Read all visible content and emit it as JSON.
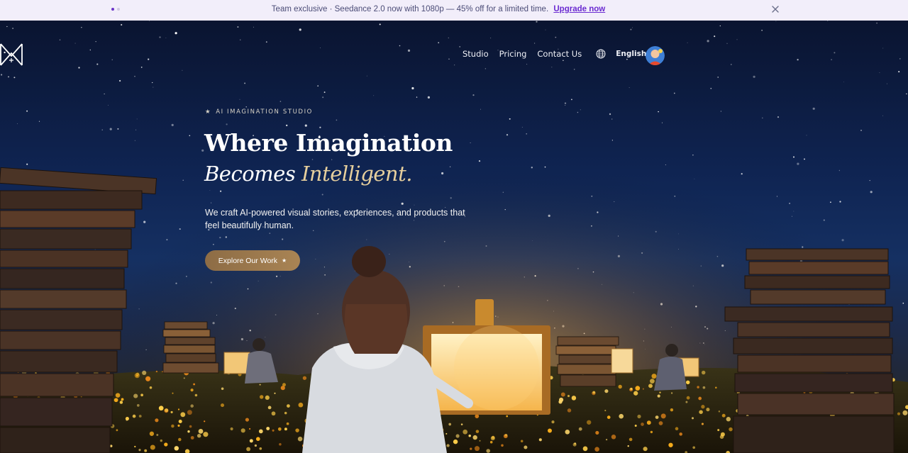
{
  "announcement": {
    "message": "Team exclusive · Seedance 2.0 now with 1080p — 45% off for a limited time.",
    "link_label": "Upgrade now",
    "close_icon": "close-icon",
    "carousel_dots": 2,
    "active_dot": 1
  },
  "nav": {
    "items": [
      {
        "label": "Studio"
      },
      {
        "label": "Pricing"
      },
      {
        "label": "Contact Us"
      }
    ],
    "language_icon": "globe-icon",
    "language": "English",
    "avatar_icon": "user-avatar"
  },
  "hero": {
    "eyebrow_star": "★",
    "eyebrow": "AI IMAGINATION STUDIO",
    "title_line1": "Where Imagination",
    "title_line2_part1": "Becomes",
    "title_line2_part2": "Intelligent.",
    "subtitle": "We craft AI-powered visual stories, experiences, and products that feel beautifully human.",
    "cta_label": "Explore Our Work",
    "cta_icon": "★"
  },
  "colors": {
    "announce_bg": "#f2eefa",
    "upgrade_link": "#6b2bd1",
    "accent_gold": "#e6cf9d",
    "cta_bg": "#a98454",
    "sky": "#0f2452"
  }
}
